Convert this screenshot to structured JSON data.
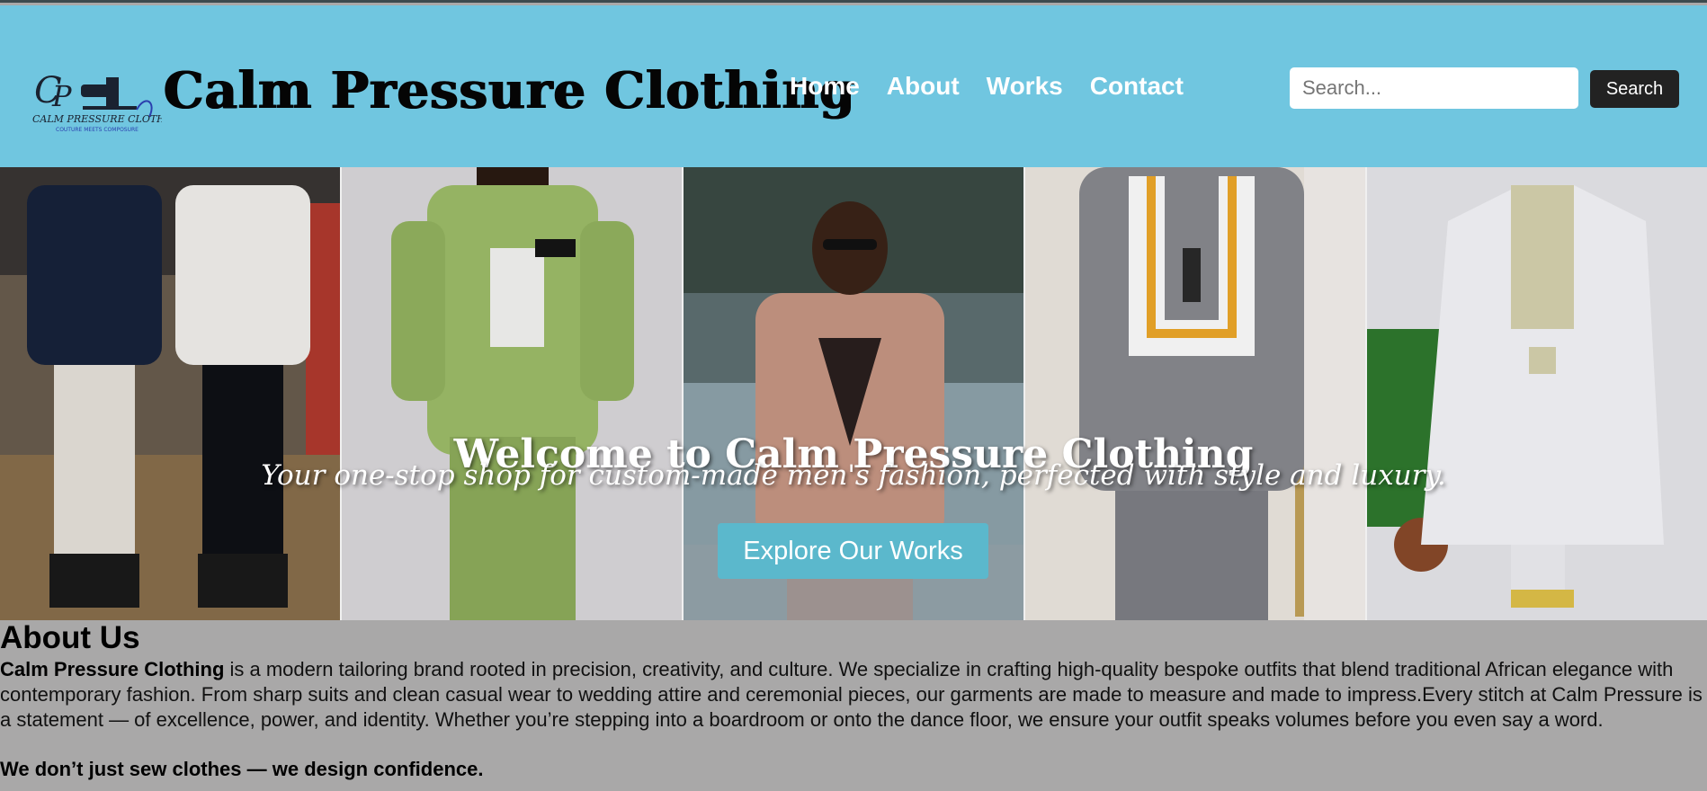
{
  "header": {
    "brand": "Calm Pressure Clothing",
    "logo_text": "CALM PRESSURE CLOTHING",
    "logo_tagline": "COUTURE MEETS COMPOSURE",
    "nav": [
      {
        "label": "Home"
      },
      {
        "label": "About"
      },
      {
        "label": "Works"
      },
      {
        "label": "Contact"
      }
    ],
    "search": {
      "placeholder": "Search...",
      "value": "",
      "button": "Search"
    }
  },
  "hero": {
    "title": "Welcome to Calm Pressure Clothing",
    "subtitle": "Your one-stop shop for custom-made men's fashion, perfected with style and luxury.",
    "cta": "Explore Our Works",
    "cta_color": "#5bb8cc"
  },
  "about": {
    "title": "About Us",
    "brand_bold": "Calm Pressure Clothing",
    "body": " is a modern tailoring brand rooted in precision, creativity, and culture. We specialize in crafting high-quality bespoke outfits that blend traditional African elegance with contemporary fashion. From sharp suits and clean casual wear to wedding attire and ceremonial pieces, our garments are made to measure and made to impress.Every stitch at Calm Pressure is a statement — of excellence, power, and identity. Whether you’re stepping into a boardroom or onto the dance floor, we ensure your outfit speaks volumes before you even say a word.",
    "tagline": "We don’t just sew clothes — we design confidence."
  },
  "colors": {
    "header_bg": "#70c6e0",
    "about_bg": "#a9a8a8",
    "search_button_bg": "#222222"
  }
}
